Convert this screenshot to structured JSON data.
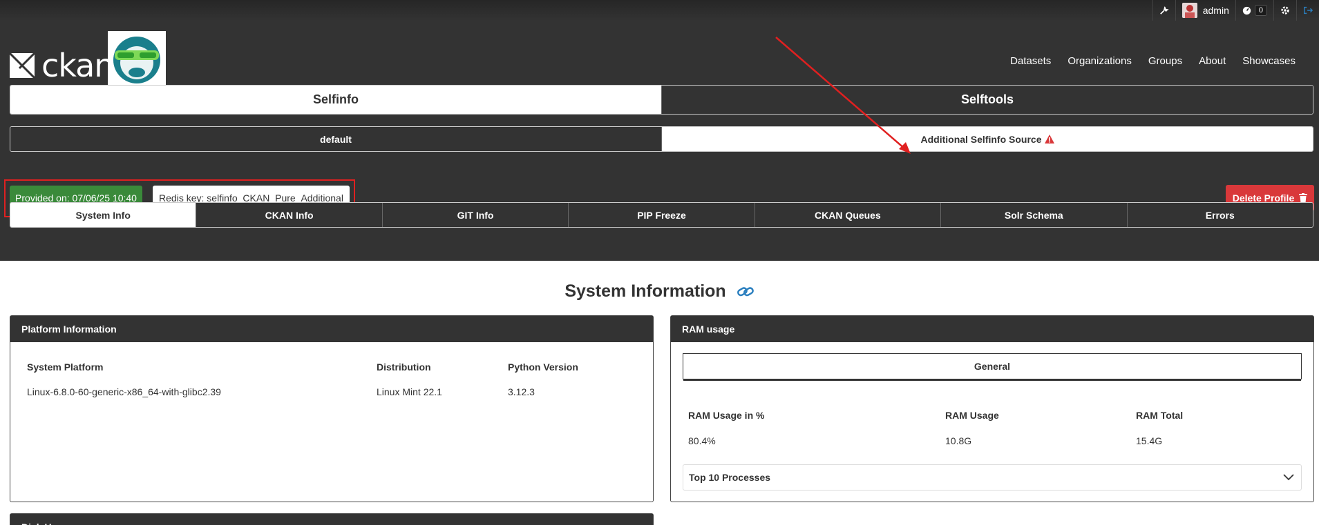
{
  "topbar": {
    "user_name": "admin",
    "notification_count": "0"
  },
  "brand": {
    "logo_text": "ckan"
  },
  "nav": [
    "Datasets",
    "Organizations",
    "Groups",
    "About",
    "Showcases"
  ],
  "tabs_main": [
    "Selfinfo",
    "Selftools"
  ],
  "tabs_source": [
    "default",
    "Additional Selfinfo Source"
  ],
  "info": {
    "provided_on": "Provided on: 07/06/25 10:40",
    "redis_key": "Redis key: selfinfo_CKAN_Pure_Additional",
    "delete_label": "Delete Profile"
  },
  "tabs_section": [
    "System Info",
    "CKAN Info",
    "GIT Info",
    "PIP Freeze",
    "CKAN Queues",
    "Solr Schema",
    "Errors"
  ],
  "page_title": "System Information",
  "platform": {
    "title": "Platform Information",
    "headers": [
      "System Platform",
      "Distribution",
      "Python Version"
    ],
    "values": [
      "Linux-6.8.0-60-generic-x86_64-with-glibc2.39",
      "Linux Mint 22.1",
      "3.12.3"
    ]
  },
  "ram": {
    "title": "RAM usage",
    "tab": "General",
    "headers": [
      "RAM Usage in %",
      "RAM Usage",
      "RAM Total"
    ],
    "values": [
      "80.4%",
      "10.8G",
      "15.4G"
    ],
    "top_processes": "Top 10 Processes"
  },
  "disk": {
    "title": "Disk Usage"
  },
  "colors": {
    "dark": "#333333",
    "green": "#3a8a3a",
    "danger": "#d9383a",
    "annotation": "#e02020"
  }
}
